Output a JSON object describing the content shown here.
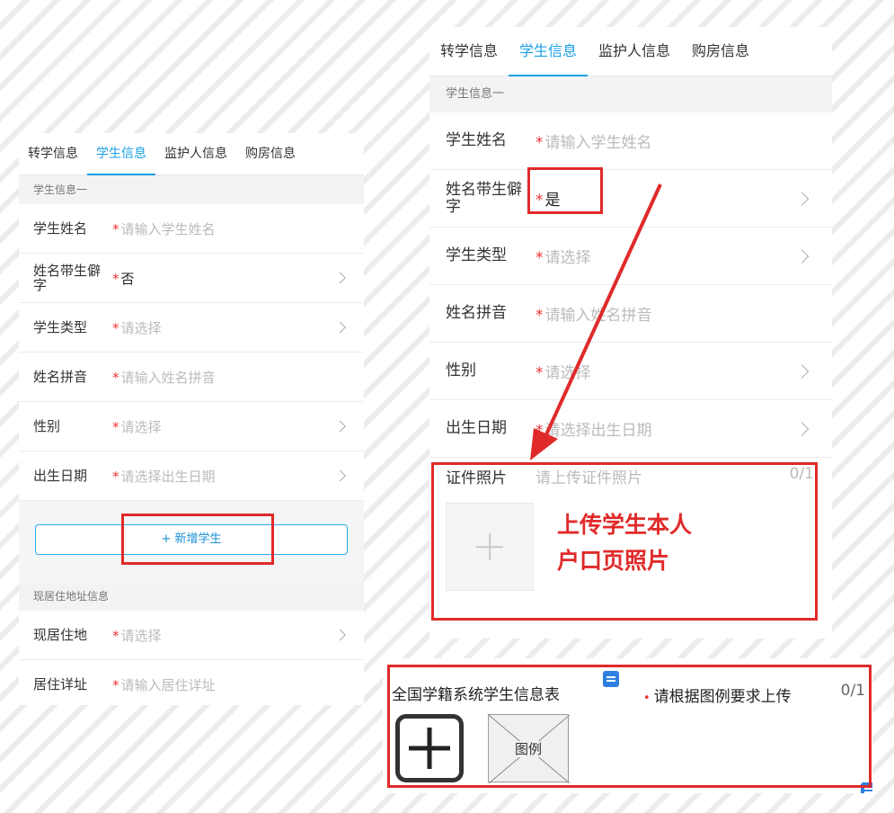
{
  "left_panel": {
    "tabs": [
      {
        "label": "转学信息",
        "active": false
      },
      {
        "label": "学生信息",
        "active": true
      },
      {
        "label": "监护人信息",
        "active": false
      },
      {
        "label": "购房信息",
        "active": false
      }
    ],
    "student_section": "学生信息一",
    "rows": [
      {
        "label": "学生姓名",
        "value": "请输入学生姓名",
        "filled": false,
        "chevron": false
      },
      {
        "label": "姓名带生僻字",
        "value": "否",
        "filled": true,
        "chevron": true
      },
      {
        "label": "学生类型",
        "value": "请选择",
        "filled": false,
        "chevron": true
      },
      {
        "label": "姓名拼音",
        "value": "请输入姓名拼音",
        "filled": false,
        "chevron": false
      },
      {
        "label": "性别",
        "value": "请选择",
        "filled": false,
        "chevron": true
      },
      {
        "label": "出生日期",
        "value": "请选择出生日期",
        "filled": false,
        "chevron": true
      }
    ],
    "add_button": "+ 新增学生",
    "address_section": "现居住地址信息",
    "address_rows": [
      {
        "label": "现居住地",
        "value": "请选择",
        "filled": false,
        "chevron": true
      },
      {
        "label": "居住详址",
        "value": "请输入居住详址",
        "filled": false,
        "chevron": false
      }
    ]
  },
  "right_panel": {
    "tabs": [
      {
        "label": "转学信息",
        "active": false
      },
      {
        "label": "学生信息",
        "active": true
      },
      {
        "label": "监护人信息",
        "active": false
      },
      {
        "label": "购房信息",
        "active": false
      }
    ],
    "student_section": "学生信息一",
    "rows": [
      {
        "label": "学生姓名",
        "value": "请输入学生姓名",
        "filled": false,
        "chevron": false
      },
      {
        "label": "姓名带生僻字",
        "value": "是",
        "filled": true,
        "chevron": true
      },
      {
        "label": "学生类型",
        "value": "请选择",
        "filled": false,
        "chevron": true
      },
      {
        "label": "姓名拼音",
        "value": "请输入姓名拼音",
        "filled": false,
        "chevron": false
      },
      {
        "label": "性别",
        "value": "请选择",
        "filled": false,
        "chevron": true
      },
      {
        "label": "出生日期",
        "value": "请选择出生日期",
        "filled": false,
        "chevron": true
      }
    ],
    "upload": {
      "label": "证件照片",
      "hint": "请上传证件照片",
      "count": "0/1"
    },
    "annotation_line1": "上传学生本人",
    "annotation_line2": "户口页照片"
  },
  "bottom_panel": {
    "title": "全国学籍系统学生信息表",
    "requirement": "请根据图例要求上传",
    "count": "0/1",
    "example_label": "图例"
  },
  "colors": {
    "accent": "#1aa0e6",
    "annotation_red": "#e02a2a",
    "required_star": "#e33333"
  }
}
